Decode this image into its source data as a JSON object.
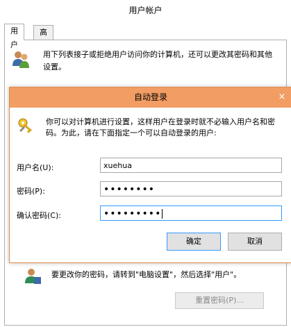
{
  "background_window": {
    "title": "用户帐户",
    "tabs": [
      "用户",
      "高级"
    ],
    "description": "用下列表接子或拒绝用户访问你的计算机，还可以更改其密码和其他设置。",
    "stub_text": "·"
  },
  "dialog": {
    "title": "自动登录",
    "close_symbol": "×",
    "description": "你可以对计算机进行设置，这样用户在登录时就不必输入用户名和密码。为此，请在下面指定一个可以自动登录的用户:",
    "username_label": "用户名(U):",
    "username_value": "xuehua",
    "password_label": "密码(P):",
    "password_value": "••••••••",
    "confirm_label": "确认密码(C):",
    "confirm_value": "•••••••••",
    "ok_label": "确定",
    "cancel_label": "取消"
  },
  "bottom": {
    "text": "要更改你的密码，请转到\"电脑设置\"，然后选择\"用户\"。",
    "reset_button": "重置密码(P)..."
  },
  "colors": {
    "dialog_titlebar": "#f29d64",
    "dialog_border": "#e08a4c",
    "focus_border": "#3399ff"
  }
}
